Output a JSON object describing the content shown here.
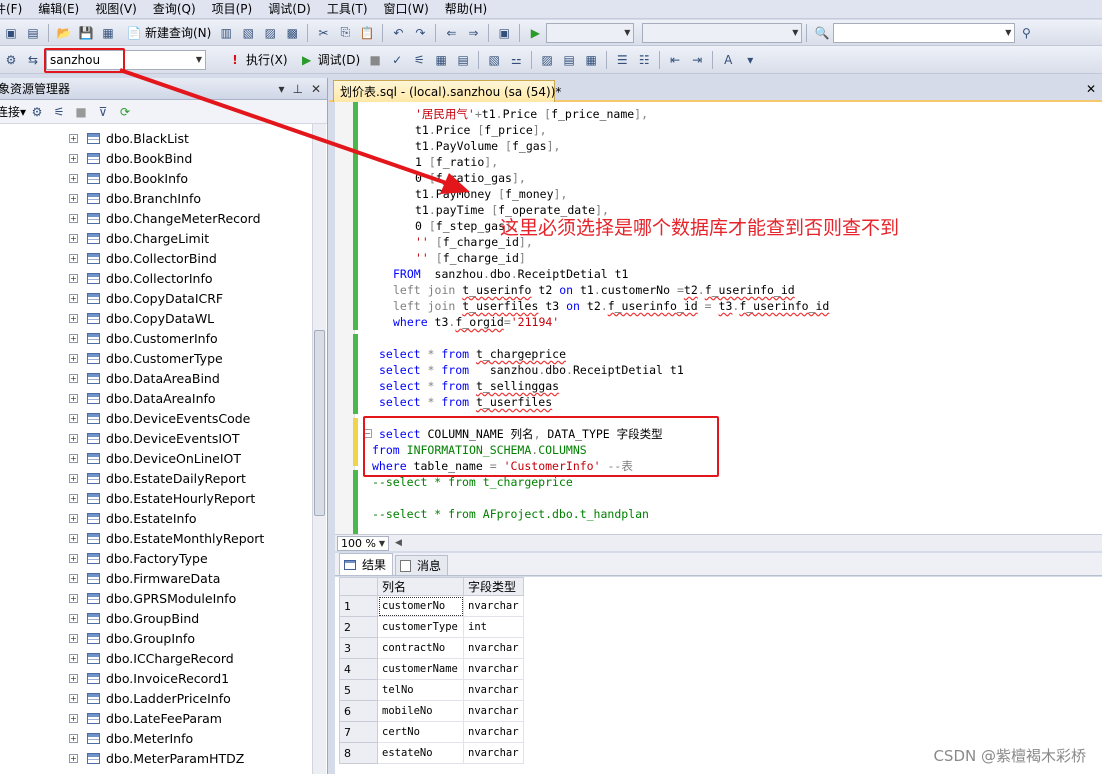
{
  "menu": [
    "件(F)",
    "编辑(E)",
    "视图(V)",
    "查询(Q)",
    "项目(P)",
    "调试(D)",
    "工具(T)",
    "窗口(W)",
    "帮助(H)"
  ],
  "toolbar1": {
    "new_query": "新建查询(N)"
  },
  "toolbar2": {
    "database": "sanzhou",
    "execute": "执行(X)",
    "debug": "调试(D)"
  },
  "object_explorer": {
    "title": "象资源管理器",
    "pin": "▾ 📌 ✕",
    "connect": "连接▾",
    "tables": [
      "dbo.BlackList",
      "dbo.BookBind",
      "dbo.BookInfo",
      "dbo.BranchInfo",
      "dbo.ChangeMeterRecord",
      "dbo.ChargeLimit",
      "dbo.CollectorBind",
      "dbo.CollectorInfo",
      "dbo.CopyDataICRF",
      "dbo.CopyDataWL",
      "dbo.CustomerInfo",
      "dbo.CustomerType",
      "dbo.DataAreaBind",
      "dbo.DataAreaInfo",
      "dbo.DeviceEventsCode",
      "dbo.DeviceEventsIOT",
      "dbo.DeviceOnLineIOT",
      "dbo.EstateDailyReport",
      "dbo.EstateHourlyReport",
      "dbo.EstateInfo",
      "dbo.EstateMonthlyReport",
      "dbo.FactoryType",
      "dbo.FirmwareData",
      "dbo.GPRSModuleInfo",
      "dbo.GroupBind",
      "dbo.GroupInfo",
      "dbo.ICChargeRecord",
      "dbo.InvoiceRecord1",
      "dbo.LadderPriceInfo",
      "dbo.LateFeeParam",
      "dbo.MeterInfo",
      "dbo.MeterParamHTDZ"
    ]
  },
  "tab": {
    "label": "划价表.sql - (local).sanzhou (sa (54))*",
    "close": "✕"
  },
  "annotation": "这里必须选择是哪个数据库才能查到否则查不到",
  "zoom": "100 %",
  "results": {
    "tabs": [
      "结果",
      "消息"
    ],
    "headers": [
      "列名",
      "字段类型"
    ],
    "rows": [
      [
        "1",
        "customerNo",
        "nvarchar"
      ],
      [
        "2",
        "customerType",
        "int"
      ],
      [
        "3",
        "contractNo",
        "nvarchar"
      ],
      [
        "4",
        "customerName",
        "nvarchar"
      ],
      [
        "5",
        "telNo",
        "nvarchar"
      ],
      [
        "6",
        "mobileNo",
        "nvarchar"
      ],
      [
        "7",
        "certNo",
        "nvarchar"
      ],
      [
        "8",
        "estateNo",
        "nvarchar"
      ]
    ]
  },
  "watermark": "CSDN @紫檀褐木彩桥"
}
